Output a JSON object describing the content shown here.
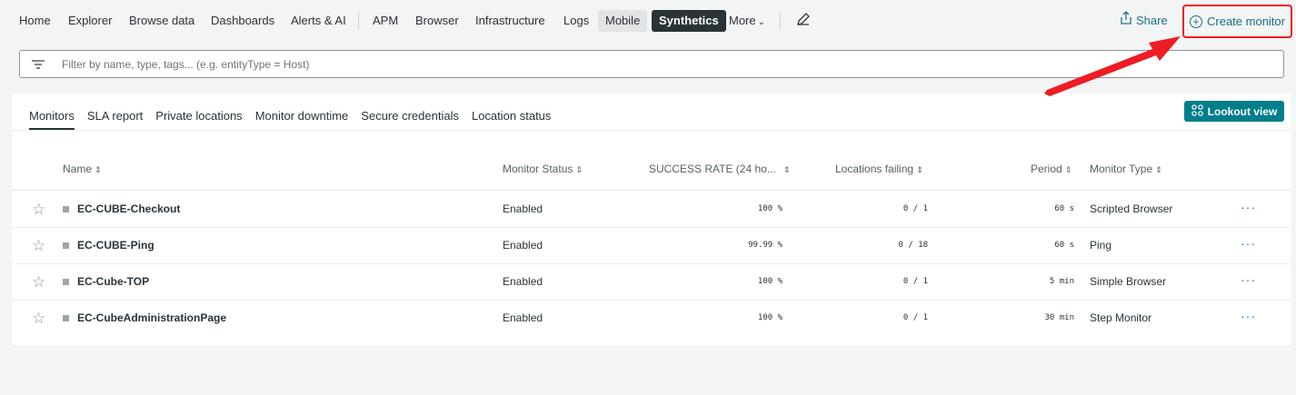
{
  "topnav": {
    "items": [
      "Home",
      "Explorer",
      "Browse data",
      "Dashboards",
      "Alerts & AI",
      "APM",
      "Browser",
      "Infrastructure",
      "Logs",
      "Mobile",
      "Synthetics",
      "More"
    ],
    "share_label": "Share",
    "create_label": "Create monitor"
  },
  "filter": {
    "placeholder": "Filter by name, type, tags... (e.g. entityType = Host)"
  },
  "tabs": [
    "Monitors",
    "SLA report",
    "Private locations",
    "Monitor downtime",
    "Secure credentials",
    "Location status"
  ],
  "lookout_label": "Lookout view",
  "table": {
    "headers": [
      "Name",
      "Monitor Status",
      "SUCCESS RATE (24 ho...",
      "Locations failing",
      "Period",
      "Monitor Type"
    ],
    "rows": [
      {
        "name": "EC-CUBE-Checkout",
        "status": "Enabled",
        "success": "100 %",
        "failing": "0 / 1",
        "period": "60 s",
        "type": "Scripted Browser"
      },
      {
        "name": "EC-CUBE-Ping",
        "status": "Enabled",
        "success": "99.99 %",
        "failing": "0 / 18",
        "period": "60 s",
        "type": "Ping"
      },
      {
        "name": "EC-Cube-TOP",
        "status": "Enabled",
        "success": "100 %",
        "failing": "0 / 1",
        "period": "5 min",
        "type": "Simple Browser"
      },
      {
        "name": "EC-CubeAdministrationPage",
        "status": "Enabled",
        "success": "100 %",
        "failing": "0 / 1",
        "period": "30 min",
        "type": "Step Monitor"
      }
    ]
  },
  "colors": {
    "accent": "#007e8a",
    "highlight_box": "#ee1c24",
    "active_tab_bg": "#293338"
  },
  "icons": {
    "share": "share-icon",
    "create": "plus-circle-icon",
    "filter": "filter-icon",
    "edit": "pencil-icon",
    "lookout": "lookout-grid-icon",
    "favorite": "star-icon",
    "row_menu": "ellipsis-icon"
  }
}
